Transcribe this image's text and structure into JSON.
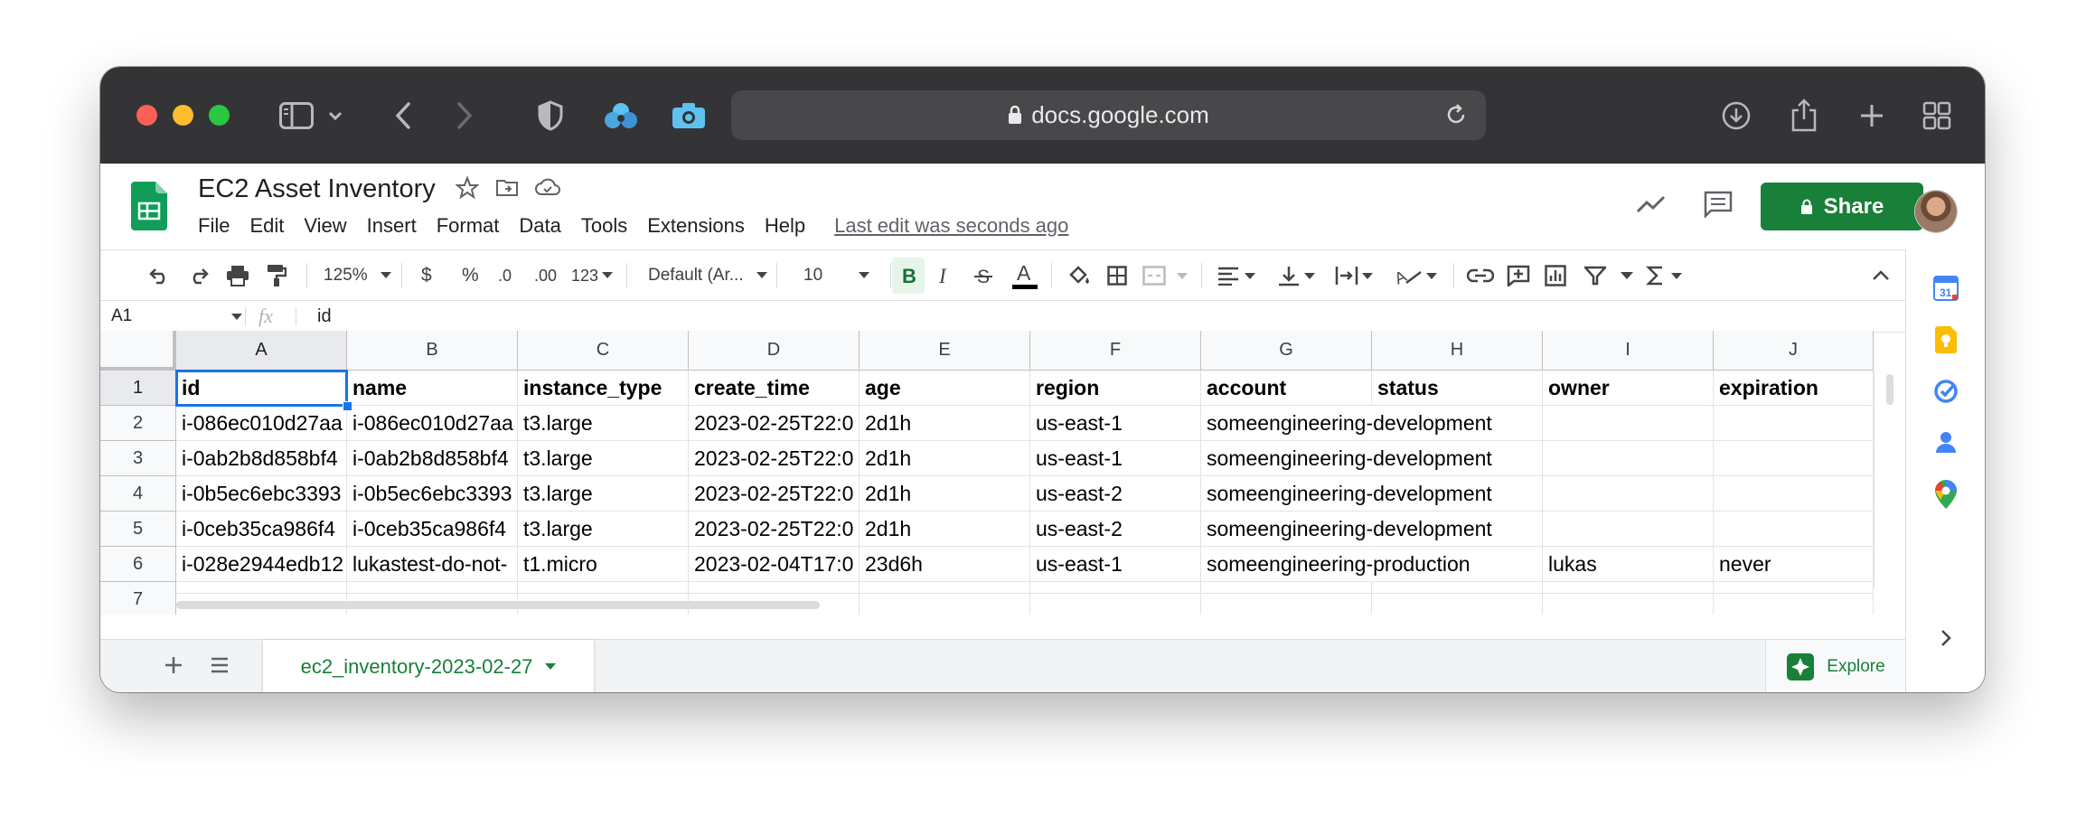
{
  "browser": {
    "url": "docs.google.com"
  },
  "doc": {
    "title": "EC2 Asset Inventory",
    "menu": [
      "File",
      "Edit",
      "View",
      "Insert",
      "Format",
      "Data",
      "Tools",
      "Extensions",
      "Help"
    ],
    "last_edit": "Last edit was seconds ago",
    "share_label": "Share"
  },
  "toolbar": {
    "zoom": "125%",
    "currency": "$",
    "percent": "%",
    "dec_decrease": ".0",
    "dec_increase": ".00",
    "more_formats": "123",
    "font": "Default (Ar...",
    "font_size": "10"
  },
  "formula": {
    "name_box": "A1",
    "fx": "fx",
    "value": "id"
  },
  "sheet": {
    "columns": [
      "A",
      "B",
      "C",
      "D",
      "E",
      "F",
      "G",
      "H",
      "I",
      "J"
    ],
    "row_numbers": [
      "1",
      "2",
      "3",
      "4",
      "5",
      "6",
      "7"
    ],
    "rows": [
      [
        "id",
        "name",
        "instance_type",
        "create_time",
        "age",
        "region",
        "account",
        "status",
        "owner",
        "expiration"
      ],
      [
        "i-086ec010d27aa",
        "i-086ec010d27aa",
        "t3.large",
        "2023-02-25T22:0",
        "2d1h",
        "us-east-1",
        "someengineering-development",
        "",
        "",
        ""
      ],
      [
        "i-0ab2b8d858bf4",
        "i-0ab2b8d858bf4",
        "t3.large",
        "2023-02-25T22:0",
        "2d1h",
        "us-east-1",
        "someengineering-development",
        "",
        "",
        ""
      ],
      [
        "i-0b5ec6ebc3393",
        "i-0b5ec6ebc3393",
        "t3.large",
        "2023-02-25T22:0",
        "2d1h",
        "us-east-2",
        "someengineering-development",
        "",
        "",
        ""
      ],
      [
        "i-0ceb35ca986f4",
        "i-0ceb35ca986f4",
        "t3.large",
        "2023-02-25T22:0",
        "2d1h",
        "us-east-2",
        "someengineering-development",
        "",
        "",
        ""
      ],
      [
        "i-028e2944edb12",
        "lukastest-do-not-",
        "t1.micro",
        "2023-02-04T17:0",
        "23d6h",
        "us-east-1",
        "someengineering-production",
        "",
        "lukas",
        "never"
      ],
      [
        "",
        "",
        "",
        "",
        "",
        "",
        "",
        "",
        "",
        ""
      ]
    ]
  },
  "bottom": {
    "sheet_tab": "ec2_inventory-2023-02-27",
    "explore": "Explore"
  },
  "colors": {
    "titlebar": "#343437",
    "brand_green": "#188038",
    "selection_blue": "#1a73e8"
  },
  "icons": [
    "sidebar-icon",
    "back-icon",
    "forward-icon",
    "shield-icon",
    "extension-icon",
    "camera-icon",
    "reload-icon",
    "download-icon",
    "share-icon",
    "new-tab-icon",
    "tab-overview-icon",
    "sheets-logo-icon",
    "star-icon",
    "move-icon",
    "cloud-icon",
    "trending-icon",
    "comment-icon",
    "lock-icon",
    "calendar-icon",
    "keep-icon",
    "tasks-icon",
    "contacts-icon",
    "maps-icon"
  ]
}
